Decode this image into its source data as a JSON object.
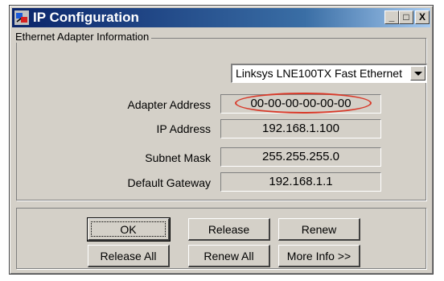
{
  "window": {
    "title": "IP Configuration",
    "controls": [
      "_",
      "□",
      "X"
    ]
  },
  "group": {
    "title": "Ethernet  Adapter Information"
  },
  "adapter_select": {
    "selected": "Linksys LNE100TX Fast Ethernet"
  },
  "fields": [
    {
      "label": "Adapter Address",
      "value": "00-00-00-00-00-00"
    },
    {
      "label": "IP Address",
      "value": "192.168.1.100"
    },
    {
      "label": "Subnet Mask",
      "value": "255.255.255.0"
    },
    {
      "label": "Default Gateway",
      "value": "192.168.1.1"
    }
  ],
  "buttons": {
    "ok": "OK",
    "release": "Release",
    "renew": "Renew",
    "release_all": "Release All",
    "renew_all": "Renew All",
    "more_info": "More Info >>"
  },
  "colors": {
    "highlight": "#d83a2a",
    "titlebar": "#0a246a"
  }
}
